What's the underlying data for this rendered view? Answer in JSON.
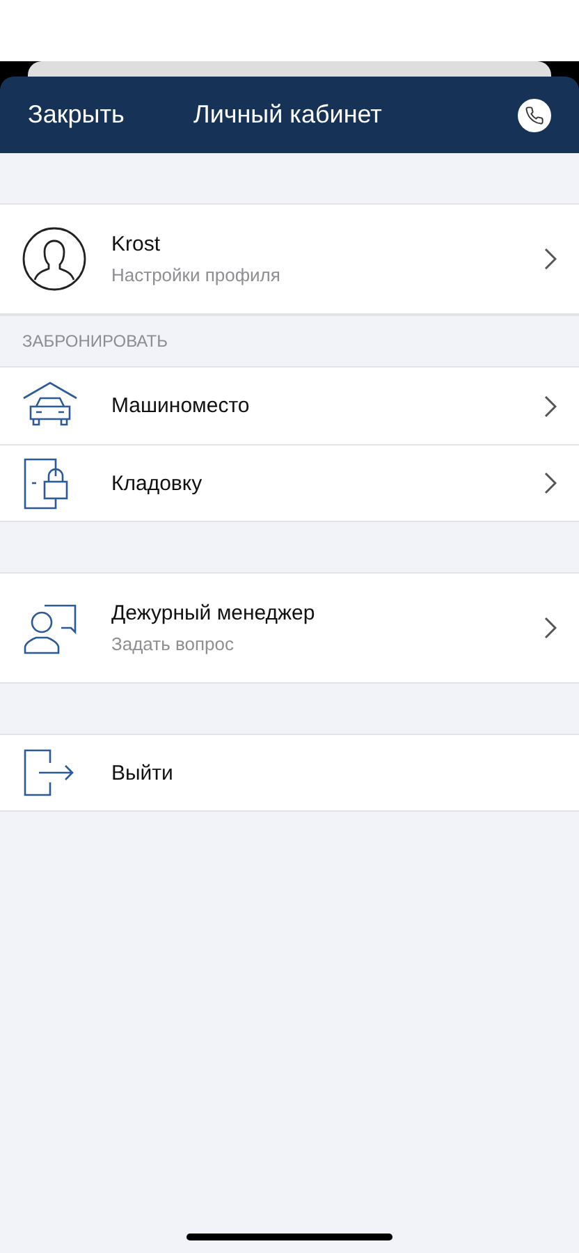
{
  "header": {
    "close": "Закрыть",
    "title": "Личный кабинет"
  },
  "sections": [
    {
      "items": [
        {
          "kind": "profile",
          "title": "Krost",
          "subtitle": "Настройки профиля",
          "chevron": true
        }
      ]
    },
    {
      "heading": "ЗАБРОНИРОВАТЬ",
      "items": [
        {
          "kind": "parking",
          "title": "Машиноместо",
          "chevron": true
        },
        {
          "kind": "storage",
          "title": "Кладовку",
          "chevron": true
        }
      ]
    },
    {
      "items": [
        {
          "kind": "manager",
          "title": "Дежурный менеджер",
          "subtitle": "Задать вопрос",
          "chevron": true
        }
      ]
    },
    {
      "items": [
        {
          "kind": "logout",
          "title": "Выйти",
          "chevron": false
        }
      ]
    }
  ]
}
